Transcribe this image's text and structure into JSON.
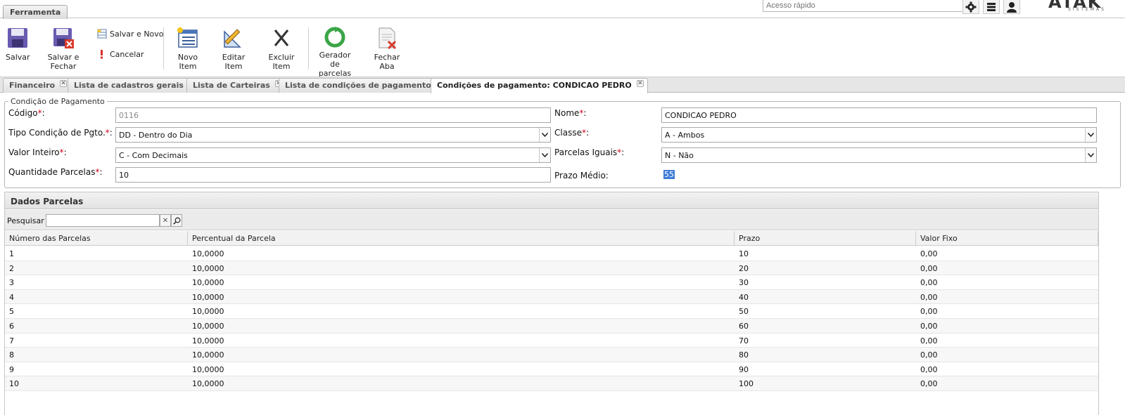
{
  "ribbon": {
    "tab_label": "Ferramenta"
  },
  "header": {
    "quick_access_placeholder": "Acesso rápido",
    "brand": "ATAK",
    "brand_sub": "SISTEMAS"
  },
  "toolbar": {
    "salvar": "Salvar",
    "salvar_fechar": "Salvar e Fechar",
    "salvar_novo": "Salvar e Novo",
    "cancelar": "Cancelar",
    "novo_item": "Novo Item",
    "editar_item": "Editar Item",
    "excluir_item": "Excluir Item",
    "gerador_line1": "Gerador",
    "gerador_line2": "de parcelas",
    "fechar_aba": "Fechar Aba"
  },
  "tabs": [
    {
      "label": "Financeiro"
    },
    {
      "label": "Lista de cadastros gerais"
    },
    {
      "label": "Lista de Carteiras"
    },
    {
      "label": "Lista de condições de pagamento"
    },
    {
      "label": "Condições de pagamento: CONDICAO PEDRO"
    }
  ],
  "form": {
    "legend": "Condição de Pagamento",
    "codigo_label": "Código",
    "codigo_value": "0116",
    "nome_label": "Nome",
    "nome_value": "CONDICAO PEDRO",
    "tipo_label": "Tipo Condição de Pgto.",
    "tipo_value": "DD - Dentro do Dia",
    "classe_label": "Classe",
    "classe_value": "A - Ambos",
    "valor_inteiro_label": "Valor Inteiro",
    "valor_inteiro_value": "C - Com Decimais",
    "parcelas_iguais_label": "Parcelas Iguais",
    "parcelas_iguais_value": "N - Não",
    "quantidade_label": "Quantidade Parcelas",
    "quantidade_value": "10",
    "prazo_medio_label": "Prazo Médio:",
    "prazo_medio_value": "55",
    "required_mark": "*",
    "colon": ":"
  },
  "grid": {
    "title": "Dados Parcelas",
    "search_label": "Pesquisar",
    "columns": [
      "Número das Parcelas",
      "Percentual da Parcela",
      "Prazo",
      "Valor Fixo"
    ],
    "rows": [
      [
        "1",
        "10,0000",
        "10",
        "0,00"
      ],
      [
        "2",
        "10,0000",
        "20",
        "0,00"
      ],
      [
        "3",
        "10,0000",
        "30",
        "0,00"
      ],
      [
        "4",
        "10,0000",
        "40",
        "0,00"
      ],
      [
        "5",
        "10,0000",
        "50",
        "0,00"
      ],
      [
        "6",
        "10,0000",
        "60",
        "0,00"
      ],
      [
        "7",
        "10,0000",
        "70",
        "0,00"
      ],
      [
        "8",
        "10,0000",
        "80",
        "0,00"
      ],
      [
        "9",
        "10,0000",
        "90",
        "0,00"
      ],
      [
        "10",
        "10,0000",
        "100",
        "0,00"
      ]
    ]
  },
  "colors": {
    "accent": "#3d7cd6",
    "required": "#d0021b",
    "panel_header": "#e2e2e2"
  }
}
